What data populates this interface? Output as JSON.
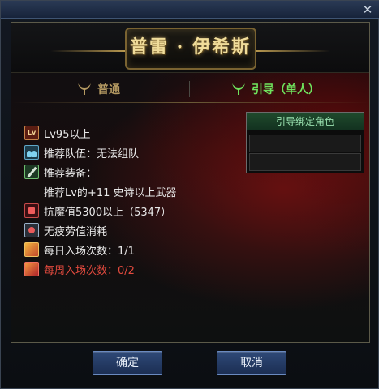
{
  "window": {
    "close_symbol": "✕"
  },
  "dungeon": {
    "title": "普雷 · 伊希斯"
  },
  "tabs": [
    {
      "label": "普通",
      "icon": "horn-icon",
      "active": false
    },
    {
      "label": "引导（单人）",
      "icon": "horn-icon",
      "active": true
    }
  ],
  "dropdown": {
    "header": "引导绑定角色",
    "slots": [
      "",
      ""
    ]
  },
  "info": [
    {
      "icon": "level-icon",
      "icon_text": "Lv",
      "text": "Lv95以上"
    },
    {
      "icon": "party-icon",
      "text": "推荐队伍：无法组队"
    },
    {
      "icon": "equip-icon",
      "text": "推荐装备："
    },
    {
      "icon": "",
      "text": "推荐Lv的+11 史诗以上武器"
    },
    {
      "icon": "resist-icon",
      "text": "抗魔值5300以上（5347）"
    },
    {
      "icon": "fatigue-icon",
      "text": "无疲劳值消耗"
    },
    {
      "icon": "ticket-icon",
      "text": "每日入场次数：1/1"
    },
    {
      "icon": "ticket-icon",
      "text": "每周入场次数：0/2",
      "color": "red"
    }
  ],
  "buttons": {
    "ok": "确定",
    "cancel": "取消"
  },
  "colors": {
    "title_gold": "#f0dc9a",
    "tab_active": "#6fe35d",
    "tab_inactive": "#b59a62",
    "warning_red": "#e24a3e"
  }
}
